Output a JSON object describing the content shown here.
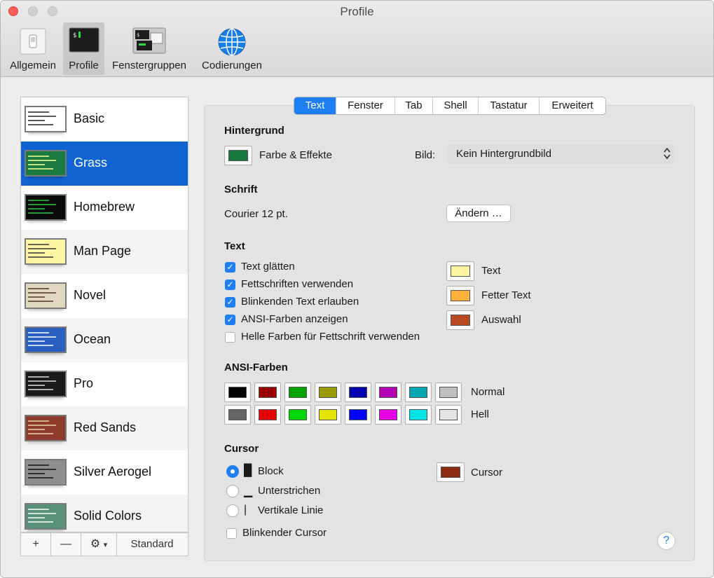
{
  "window": {
    "title": "Profile"
  },
  "toolbar": {
    "items": [
      {
        "label": "Allgemein",
        "icon": "switch-icon"
      },
      {
        "label": "Profile",
        "icon": "terminal-icon",
        "selected": true
      },
      {
        "label": "Fenstergruppen",
        "icon": "window-groups-icon"
      },
      {
        "label": "Codierungen",
        "icon": "globe-icon"
      }
    ]
  },
  "profiles": {
    "items": [
      {
        "name": "Basic",
        "bg": "#ffffff",
        "fg": "#222222"
      },
      {
        "name": "Grass",
        "bg": "#1b7a40",
        "fg": "#ffff9a",
        "selected": true
      },
      {
        "name": "Homebrew",
        "bg": "#0a0a0a",
        "fg": "#27c93f"
      },
      {
        "name": "Man Page",
        "bg": "#fdf4a4",
        "fg": "#333333"
      },
      {
        "name": "Novel",
        "bg": "#e0d8bf",
        "fg": "#553322"
      },
      {
        "name": "Ocean",
        "bg": "#2a5fbf",
        "fg": "#ffffff"
      },
      {
        "name": "Pro",
        "bg": "#1a1a1a",
        "fg": "#e0e0e0"
      },
      {
        "name": "Red Sands",
        "bg": "#8e3a2c",
        "fg": "#e8d7a6"
      },
      {
        "name": "Silver Aerogel",
        "bg": "#8f8f8f",
        "fg": "#111111"
      },
      {
        "name": "Solid Colors",
        "bg": "#57917a",
        "fg": "#ffffff"
      }
    ],
    "footer": {
      "add": "+",
      "remove": "—",
      "action": "⚙",
      "default_label": "Standard"
    }
  },
  "tabs": [
    {
      "label": "Text",
      "active": true
    },
    {
      "label": "Fenster"
    },
    {
      "label": "Tab"
    },
    {
      "label": "Shell"
    },
    {
      "label": "Tastatur"
    },
    {
      "label": "Erweitert"
    }
  ],
  "background": {
    "heading": "Hintergrund",
    "color_label": "Farbe & Effekte",
    "color": "#177a3c",
    "image_label": "Bild:",
    "image_value": "Kein Hintergrundbild"
  },
  "font": {
    "heading": "Schrift",
    "value": "Courier 12 pt.",
    "change_button": "Ändern …"
  },
  "text": {
    "heading": "Text",
    "options": [
      {
        "label": "Text glätten",
        "checked": true
      },
      {
        "label": "Fettschriften verwenden",
        "checked": true
      },
      {
        "label": "Blinkenden Text erlauben",
        "checked": true
      },
      {
        "label": "ANSI-Farben anzeigen",
        "checked": true
      },
      {
        "label": "Helle Farben für Fettschrift verwenden",
        "checked": false
      }
    ],
    "colors": [
      {
        "label": "Text",
        "color": "#fff4a2"
      },
      {
        "label": "Fetter Text",
        "color": "#ffb23c"
      },
      {
        "label": "Auswahl",
        "color": "#b84a22"
      }
    ]
  },
  "ansi": {
    "heading": "ANSI-Farben",
    "normal_label": "Normal",
    "bright_label": "Hell",
    "normal": [
      "#000000",
      "#990000",
      "#00a600",
      "#999900",
      "#0000b2",
      "#b200b2",
      "#00a6b2",
      "#bfbfbf"
    ],
    "bright": [
      "#666666",
      "#e50000",
      "#00d900",
      "#e5e500",
      "#0000ff",
      "#e500e5",
      "#00e5e5",
      "#e5e5e5"
    ]
  },
  "cursor": {
    "heading": "Cursor",
    "styles": [
      {
        "label": "Block",
        "selected": true,
        "glyph": "█"
      },
      {
        "label": "Unterstrichen",
        "selected": false,
        "glyph": "▁"
      },
      {
        "label": "Vertikale Linie",
        "selected": false,
        "glyph": "|"
      }
    ],
    "blink_label": "Blinkender Cursor",
    "blink_checked": false,
    "color_label": "Cursor",
    "color": "#8b2a10"
  },
  "help": {
    "label": "?"
  }
}
